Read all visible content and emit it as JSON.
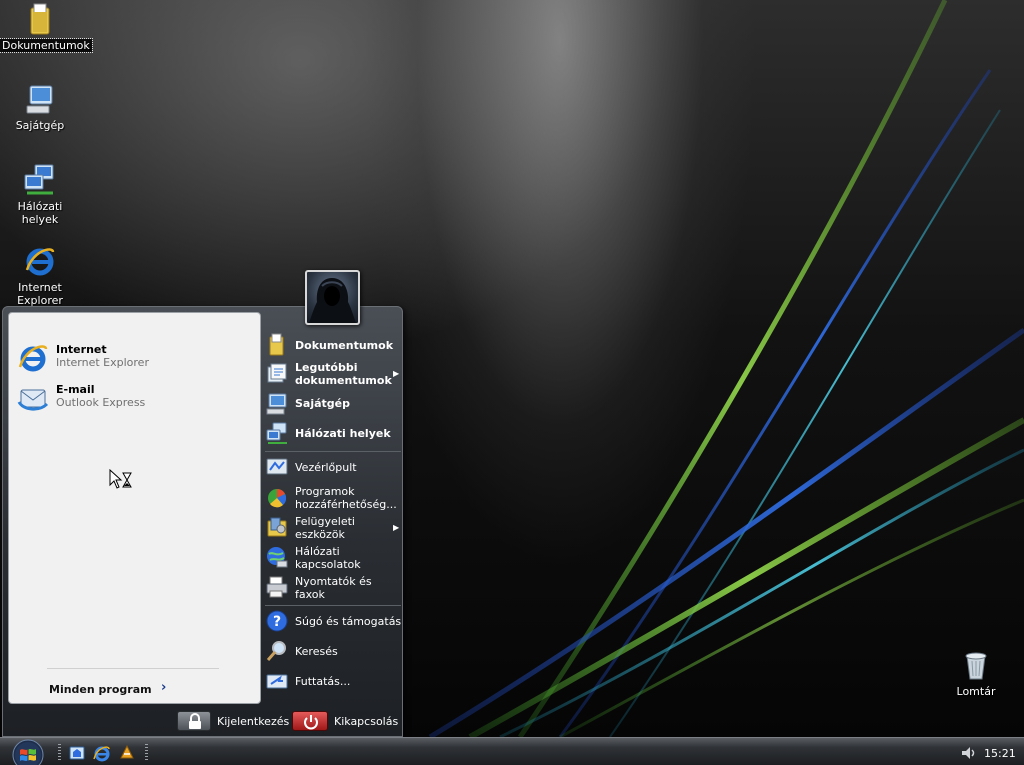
{
  "desktop": {
    "icons": [
      {
        "label": "Dokumentumok"
      },
      {
        "label": "Sajátgép"
      },
      {
        "label": "Hálózati helyek"
      },
      {
        "label": "Internet Explorer"
      },
      {
        "label": "Lomtár"
      }
    ]
  },
  "start_menu": {
    "pinned": [
      {
        "title": "Internet",
        "subtitle": "Internet Explorer",
        "icon": "internet-explorer-icon"
      },
      {
        "title": "E-mail",
        "subtitle": "Outlook Express",
        "icon": "outlook-express-icon"
      }
    ],
    "all_programs": "Minden program",
    "right_items_top": [
      {
        "label": "Dokumentumok",
        "icon": "documents-folder-icon"
      },
      {
        "label": "Legutóbbi dokumentumok",
        "icon": "recent-documents-icon"
      },
      {
        "label": "Sajátgép",
        "icon": "my-computer-icon"
      },
      {
        "label": "Hálózati helyek",
        "icon": "network-places-icon"
      }
    ],
    "right_items_mid": [
      {
        "label": "Vezérlőpult",
        "icon": "control-panel-icon"
      },
      {
        "label": "Programok hozzáférhetőség...",
        "icon": "program-access-icon"
      },
      {
        "label": "Felügyeleti eszközök",
        "icon": "admin-tools-icon"
      },
      {
        "label": "Hálózati kapcsolatok",
        "icon": "network-connections-icon"
      },
      {
        "label": "Nyomtatók és faxok",
        "icon": "printers-icon"
      }
    ],
    "right_items_bottom": [
      {
        "label": "Súgó és támogatás",
        "icon": "help-icon"
      },
      {
        "label": "Keresés",
        "icon": "search-icon"
      },
      {
        "label": "Futtatás...",
        "icon": "run-icon"
      }
    ],
    "logoff": "Kijelentkezés",
    "shutdown": "Kikapcsolás"
  },
  "taskbar": {
    "clock": "15:21"
  },
  "colors": {
    "shutdown_red": "#c62828",
    "logoff_gray": "#5f646a",
    "ie_blue": "#1e6fd0"
  }
}
